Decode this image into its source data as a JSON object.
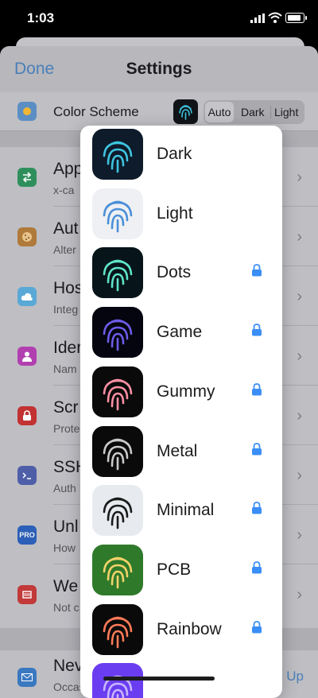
{
  "status": {
    "time": "1:03"
  },
  "nav": {
    "done": "Done",
    "title": "Settings"
  },
  "color_scheme": {
    "label": "Color Scheme",
    "options": [
      "Auto",
      "Dark",
      "Light"
    ],
    "selected": "Auto"
  },
  "rows": [
    {
      "title": "App",
      "sub": "x-ca",
      "icon": "arrows-icon",
      "color": "#2f8f5c"
    },
    {
      "title": "Aut",
      "sub": "Alter",
      "icon": "cookie-icon",
      "color": "#b07a3a"
    },
    {
      "title": "Hos",
      "sub": "Integ",
      "icon": "cloud-icon",
      "color": "#5aa8d6"
    },
    {
      "title": "Ider",
      "sub": "Nam",
      "icon": "person-icon",
      "color": "#b23fb0"
    },
    {
      "title": "Scr",
      "sub": "Prote",
      "icon": "lock-icon",
      "color": "#c23232"
    },
    {
      "title": "SSH",
      "sub": "Auth",
      "icon": "terminal-icon",
      "color": "#4e5fa8"
    },
    {
      "title": "Unl",
      "sub": "How",
      "icon": "pro-icon",
      "color": "#2c5fb8",
      "badge": "PRO"
    },
    {
      "title": "We",
      "sub": "Not c",
      "icon": "card-icon",
      "color": "#c23a3a"
    }
  ],
  "news": {
    "title": "Nev",
    "sub": "Occasional announcements",
    "action": "Sign Up",
    "icon": "mail-icon",
    "color": "#3a78c0"
  },
  "themes": [
    {
      "label": "Dark",
      "locked": false,
      "bg": "#0e1b2b",
      "fg": "#3ec4e0"
    },
    {
      "label": "Light",
      "locked": false,
      "bg": "#eef0f3",
      "fg": "#4a8fd8"
    },
    {
      "label": "Dots",
      "locked": true,
      "bg": "#07151a",
      "fg": "#5fe3c8"
    },
    {
      "label": "Game",
      "locked": true,
      "bg": "#050510",
      "fg": "#6c5ce7"
    },
    {
      "label": "Gummy",
      "locked": true,
      "bg": "#0a0a0a",
      "fg": "#ff8fa3"
    },
    {
      "label": "Metal",
      "locked": true,
      "bg": "#0a0a0a",
      "fg": "#c9c9c9"
    },
    {
      "label": "Minimal",
      "locked": true,
      "bg": "#e7ebf0",
      "fg": "#1a1a1a"
    },
    {
      "label": "PCB",
      "locked": true,
      "bg": "#2f7a2a",
      "fg": "#f3d26a"
    },
    {
      "label": "Rainbow",
      "locked": true,
      "bg": "#0a0a0a",
      "fg": "#ff7a59"
    },
    {
      "label": "",
      "locked": false,
      "bg": "#6b3df0",
      "fg": "#c7b6ff"
    }
  ],
  "colors": {
    "accent": "#4a7fb8",
    "lock": "#3a8ef6"
  }
}
